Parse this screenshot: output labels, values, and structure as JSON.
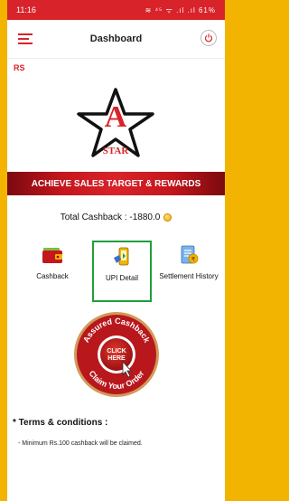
{
  "status_bar": {
    "time": "11:16",
    "icons_text": "≋ ⁴⁵ ᯤ .ıl .ıl",
    "battery": "61%"
  },
  "header": {
    "title": "Dashboard"
  },
  "brand": {
    "small_logo": "RS",
    "logo_text": "STAR"
  },
  "banner": {
    "text": "ACHIEVE SALES TARGET & REWARDS"
  },
  "cashback": {
    "label": "Total Cashback : -1880.0"
  },
  "tiles": [
    {
      "label": "Cashback",
      "icon": "wallet-icon"
    },
    {
      "label": "UPI Detail",
      "icon": "upi-phone-icon",
      "selected": true
    },
    {
      "label": "Settlement History",
      "icon": "receipt-icon"
    }
  ],
  "cta": {
    "top_text": "Assured Cashback",
    "center_line1": "CLICK",
    "center_line2": "HERE",
    "bottom_text": "Claim Your Order"
  },
  "terms": {
    "title": "* Terms & conditions :",
    "items": [
      "- Minimum Rs.100 cashback will be claimed."
    ]
  },
  "colors": {
    "primary": "#d8232a",
    "highlight": "#1f9f3a",
    "frame": "#f2b400"
  }
}
